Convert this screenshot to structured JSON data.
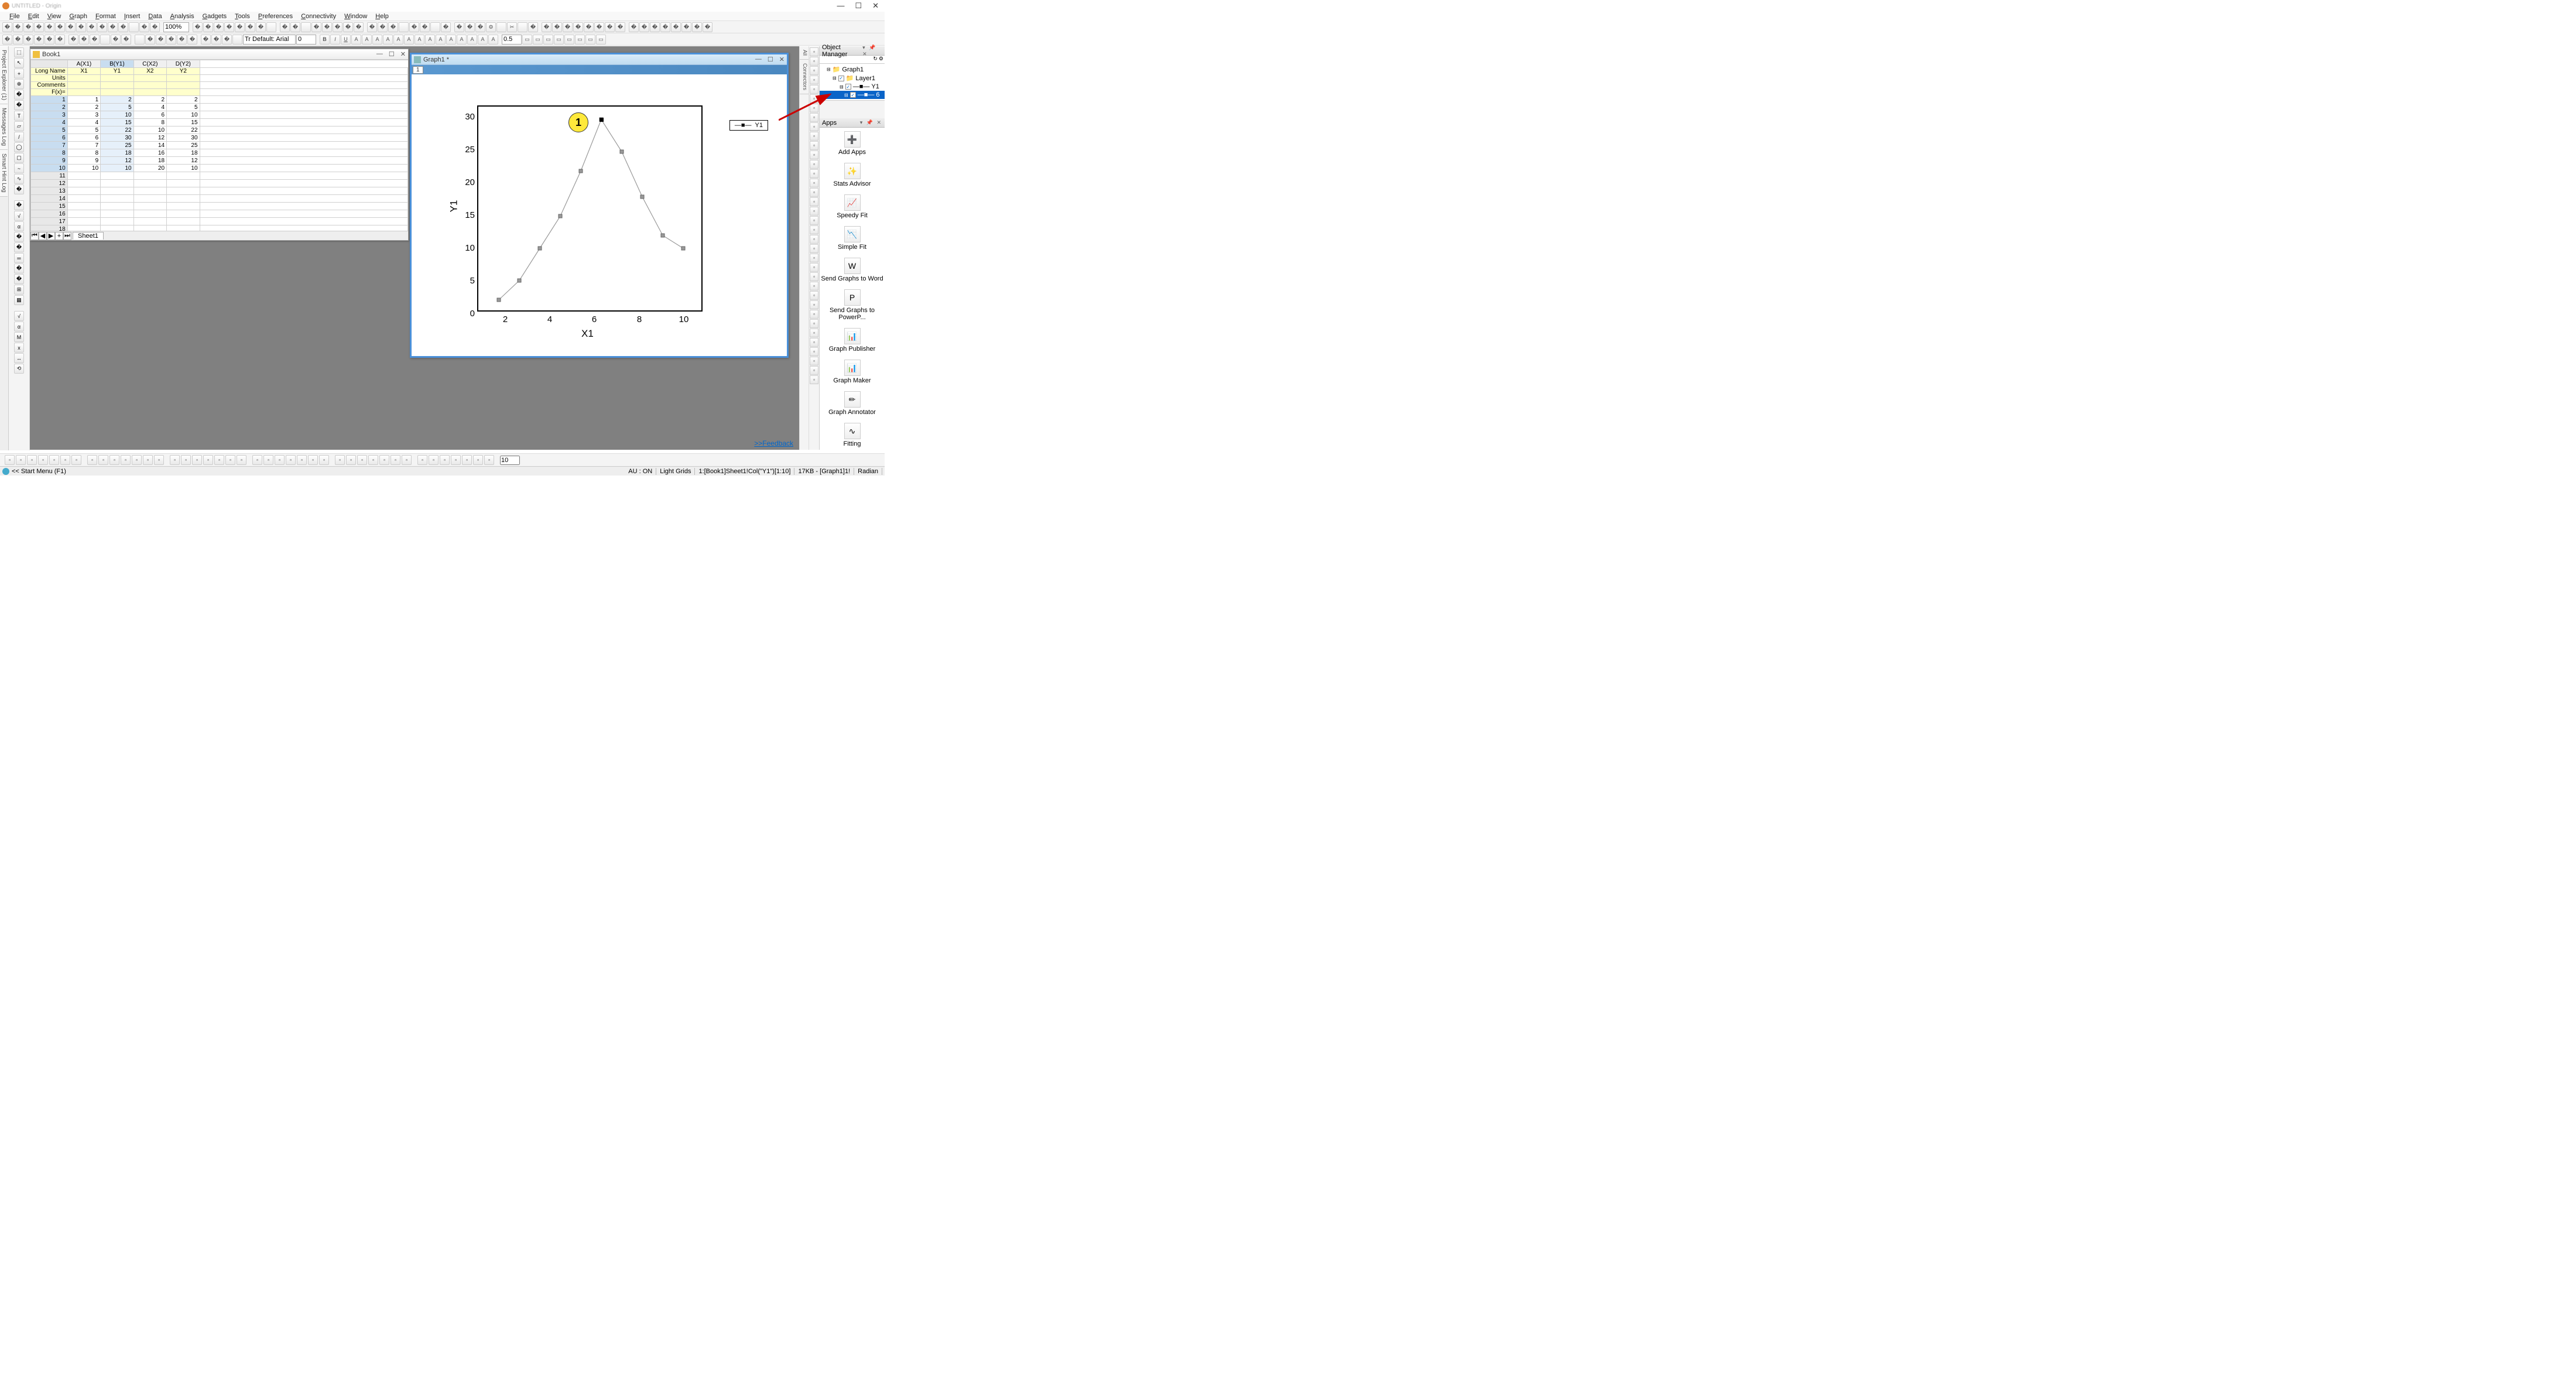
{
  "title_blurred": "UNTITLED - Origin",
  "window_controls": {
    "min": "—",
    "max": "☐",
    "close": "✕"
  },
  "menu": [
    "File",
    "Edit",
    "View",
    "Graph",
    "Format",
    "Insert",
    "Data",
    "Analysis",
    "Gadgets",
    "Tools",
    "Preferences",
    "Connectivity",
    "Window",
    "Help"
  ],
  "toolbar1_zoom": "100%",
  "toolbar2": {
    "font": "Tr Default: Arial",
    "fontsize": "0",
    "linewidth": "0.5"
  },
  "left_tabs": [
    "Project Explorer (1)",
    "Messages Log",
    "Smart Hint Log"
  ],
  "book": {
    "title": "Book1",
    "columns": [
      "A(X1)",
      "B(Y1)",
      "C(X2)",
      "D(Y2)"
    ],
    "longname": [
      "X1",
      "Y1",
      "X2",
      "Y2"
    ],
    "row_labels": [
      "Long Name",
      "Units",
      "Comments",
      "F(x)="
    ],
    "data_rows": [
      {
        "n": 1,
        "a": 1,
        "b": 2,
        "c": 2,
        "d": 2
      },
      {
        "n": 2,
        "a": 2,
        "b": 5,
        "c": 4,
        "d": 5
      },
      {
        "n": 3,
        "a": 3,
        "b": 10,
        "c": 6,
        "d": 10
      },
      {
        "n": 4,
        "a": 4,
        "b": 15,
        "c": 8,
        "d": 15
      },
      {
        "n": 5,
        "a": 5,
        "b": 22,
        "c": 10,
        "d": 22
      },
      {
        "n": 6,
        "a": 6,
        "b": 30,
        "c": 12,
        "d": 30
      },
      {
        "n": 7,
        "a": 7,
        "b": 25,
        "c": 14,
        "d": 25
      },
      {
        "n": 8,
        "a": 8,
        "b": 18,
        "c": 16,
        "d": 18
      },
      {
        "n": 9,
        "a": 9,
        "b": 12,
        "c": 18,
        "d": 12
      },
      {
        "n": 10,
        "a": 10,
        "b": 10,
        "c": 20,
        "d": 10
      }
    ],
    "empty_rows": [
      11,
      12,
      13,
      14,
      15,
      16,
      17,
      18
    ],
    "sheet": "Sheet1",
    "selected_col": 1
  },
  "graph": {
    "title": "Graph1 *",
    "page": "1",
    "legend": "Y1",
    "ylabel": "Y1",
    "xlabel": "X1",
    "yticks": [
      {
        "v": "0",
        "y": 400
      },
      {
        "v": "5",
        "y": 344
      },
      {
        "v": "10",
        "y": 288
      },
      {
        "v": "15",
        "y": 232
      },
      {
        "v": "20",
        "y": 176
      },
      {
        "v": "25",
        "y": 120
      },
      {
        "v": "30",
        "y": 64
      }
    ],
    "xticks": [
      {
        "v": "2",
        "x": 150
      },
      {
        "v": "4",
        "x": 226
      },
      {
        "v": "6",
        "x": 302
      },
      {
        "v": "8",
        "x": 379
      },
      {
        "v": "10",
        "x": 455
      }
    ],
    "callout": "1"
  },
  "chart_data": {
    "type": "line",
    "title": "",
    "xlabel": "X1",
    "ylabel": "Y1",
    "xlim": [
      0,
      11
    ],
    "ylim": [
      0,
      32
    ],
    "series": [
      {
        "name": "Y1",
        "marker": "square",
        "color": "#999999",
        "x": [
          1,
          2,
          3,
          4,
          5,
          6,
          7,
          8,
          9,
          10
        ],
        "y": [
          2,
          5,
          10,
          15,
          22,
          30,
          25,
          18,
          12,
          10
        ]
      }
    ],
    "legend_position": "top-right"
  },
  "feedback": ">>Feedback",
  "object_manager": {
    "title": "Object Manager",
    "tree": [
      {
        "label": "Graph1",
        "lvl": 0
      },
      {
        "label": "Layer1",
        "lvl": 1,
        "chk": true
      },
      {
        "label": "Y1",
        "lvl": 2,
        "chk": true,
        "glyph": "■"
      },
      {
        "label": "6",
        "lvl": 3,
        "chk": true,
        "glyph": "■",
        "sel": true
      }
    ]
  },
  "right_side_tabs": [
    "All",
    "Connectors"
  ],
  "apps": {
    "title": "Apps",
    "items": [
      {
        "name": "Add Apps",
        "glyph": "➕"
      },
      {
        "name": "Stats Advisor",
        "glyph": "✨"
      },
      {
        "name": "Speedy Fit",
        "glyph": "📈"
      },
      {
        "name": "Simple Fit",
        "glyph": "📉"
      },
      {
        "name": "Send Graphs to Word",
        "glyph": "W"
      },
      {
        "name": "Send Graphs to PowerP...",
        "glyph": "P"
      },
      {
        "name": "Graph Publisher",
        "glyph": "📊"
      },
      {
        "name": "Graph Maker",
        "glyph": "📊"
      },
      {
        "name": "Graph Annotator",
        "glyph": "✏"
      },
      {
        "name": "Fitting",
        "glyph": "∿"
      }
    ]
  },
  "bottombar_combo": "10",
  "status": {
    "start": "<< Start Menu (F1)",
    "au": "AU : ON",
    "grids": "Light Grids",
    "range": "1:[Book1]Sheet1!Col(\"Y1\")[1:10]",
    "size": "17KB - [Graph1]1!",
    "mode": "Radian"
  }
}
